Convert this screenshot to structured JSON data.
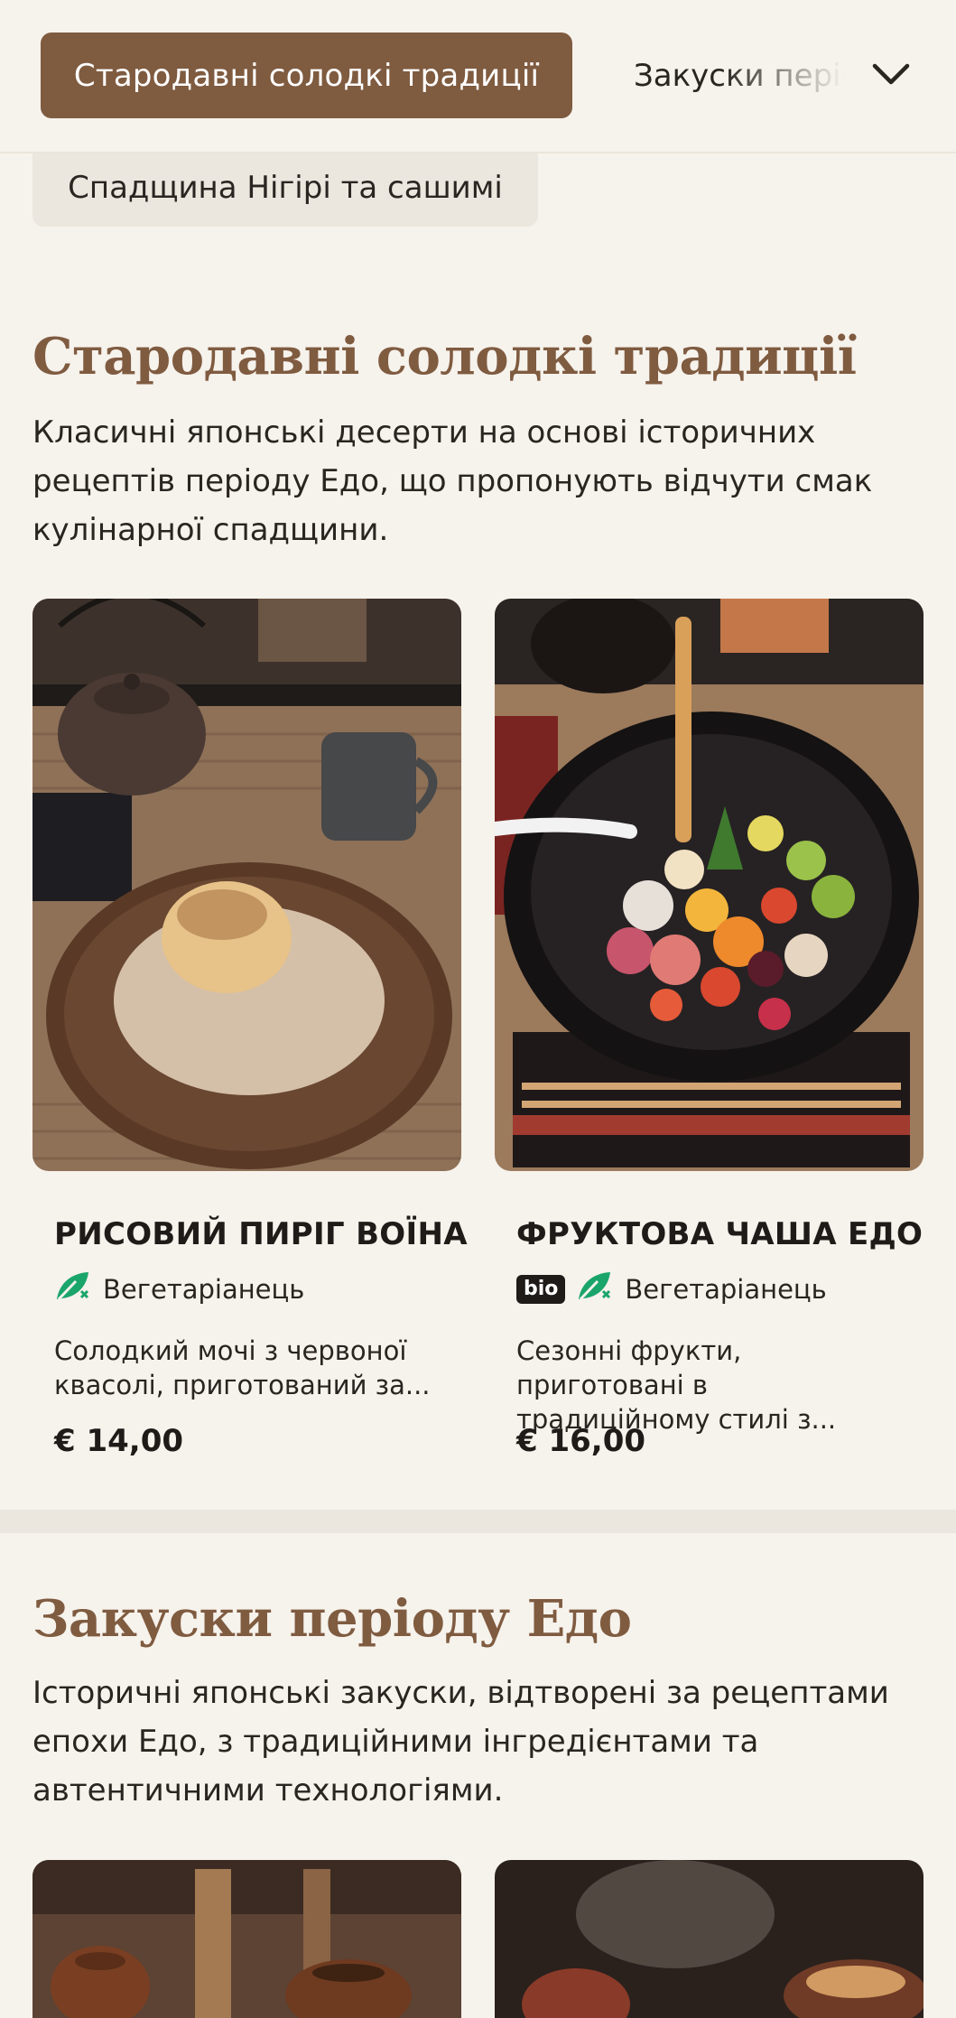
{
  "nav": {
    "active_tab": "Стародавні солодкі традиції",
    "next_tab": "Закуски періоду Едо",
    "secondary_tab": "Спадщина Нігірі та сашимі"
  },
  "sections": [
    {
      "title": "Стародавні солодкі традиції",
      "description": "Класичні японські десерти на основі історичних рецептів періоду Едо, що пропонують відчути смак кулінарної спадщини.",
      "items": [
        {
          "name": "РИСОВИЙ ПИРІГ ВОЇНА",
          "diet": "Вегетаріанець",
          "bio": "",
          "description": "Солодкий мочі з червоної квасолі, приготований за...",
          "price": "€ 14,00"
        },
        {
          "name": "ФРУКТОВА ЧАША ЕДО",
          "diet": "Вегетаріанець",
          "bio": "bio",
          "description": "Сезонні фрукти, приготовані в традиційному стилі з...",
          "price": "€ 16,00"
        }
      ]
    },
    {
      "title": "Закуски періоду Едо",
      "description": "Історичні японські закуски, відтворені за рецептами епохи Едо, з традиційними інгредієнтами та автентичними технологіями."
    }
  ],
  "colors": {
    "accent": "#7f5b40",
    "background": "#f6f2ec",
    "veg_icon": "#1aa56a"
  },
  "icons": {
    "diet": "vegetarian-leaf-icon",
    "nav_toggle": "chevron-down-icon"
  }
}
